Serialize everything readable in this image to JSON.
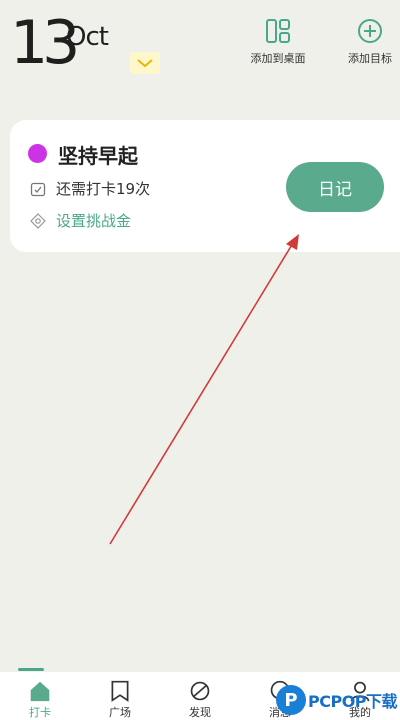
{
  "header": {
    "day": "13",
    "month": "Oct",
    "actions": [
      {
        "label": "添加到桌面",
        "icon": "widget-grid-icon"
      },
      {
        "label": "添加目标",
        "icon": "add-circle-icon"
      }
    ]
  },
  "habit_card": {
    "title": "坚持早起",
    "dot_color": "#cc33e6",
    "remaining": "还需打卡19次",
    "challenge": "设置挑战金",
    "diary_button": "日记"
  },
  "bottom_nav": {
    "items": [
      {
        "label": "打卡",
        "icon": "house-icon",
        "active": true
      },
      {
        "label": "广场",
        "icon": "bookmark-icon",
        "active": false
      },
      {
        "label": "发现",
        "icon": "planet-icon",
        "active": false
      },
      {
        "label": "消息",
        "icon": "message-icon",
        "active": false
      },
      {
        "label": "我的",
        "icon": "person-icon",
        "active": false
      }
    ]
  },
  "watermark": {
    "logo_letter": "P",
    "text": "PCPOP下载"
  },
  "colors": {
    "accent": "#5aaa8d",
    "background": "#f0f0ea",
    "arrow": "#d23a3a"
  }
}
